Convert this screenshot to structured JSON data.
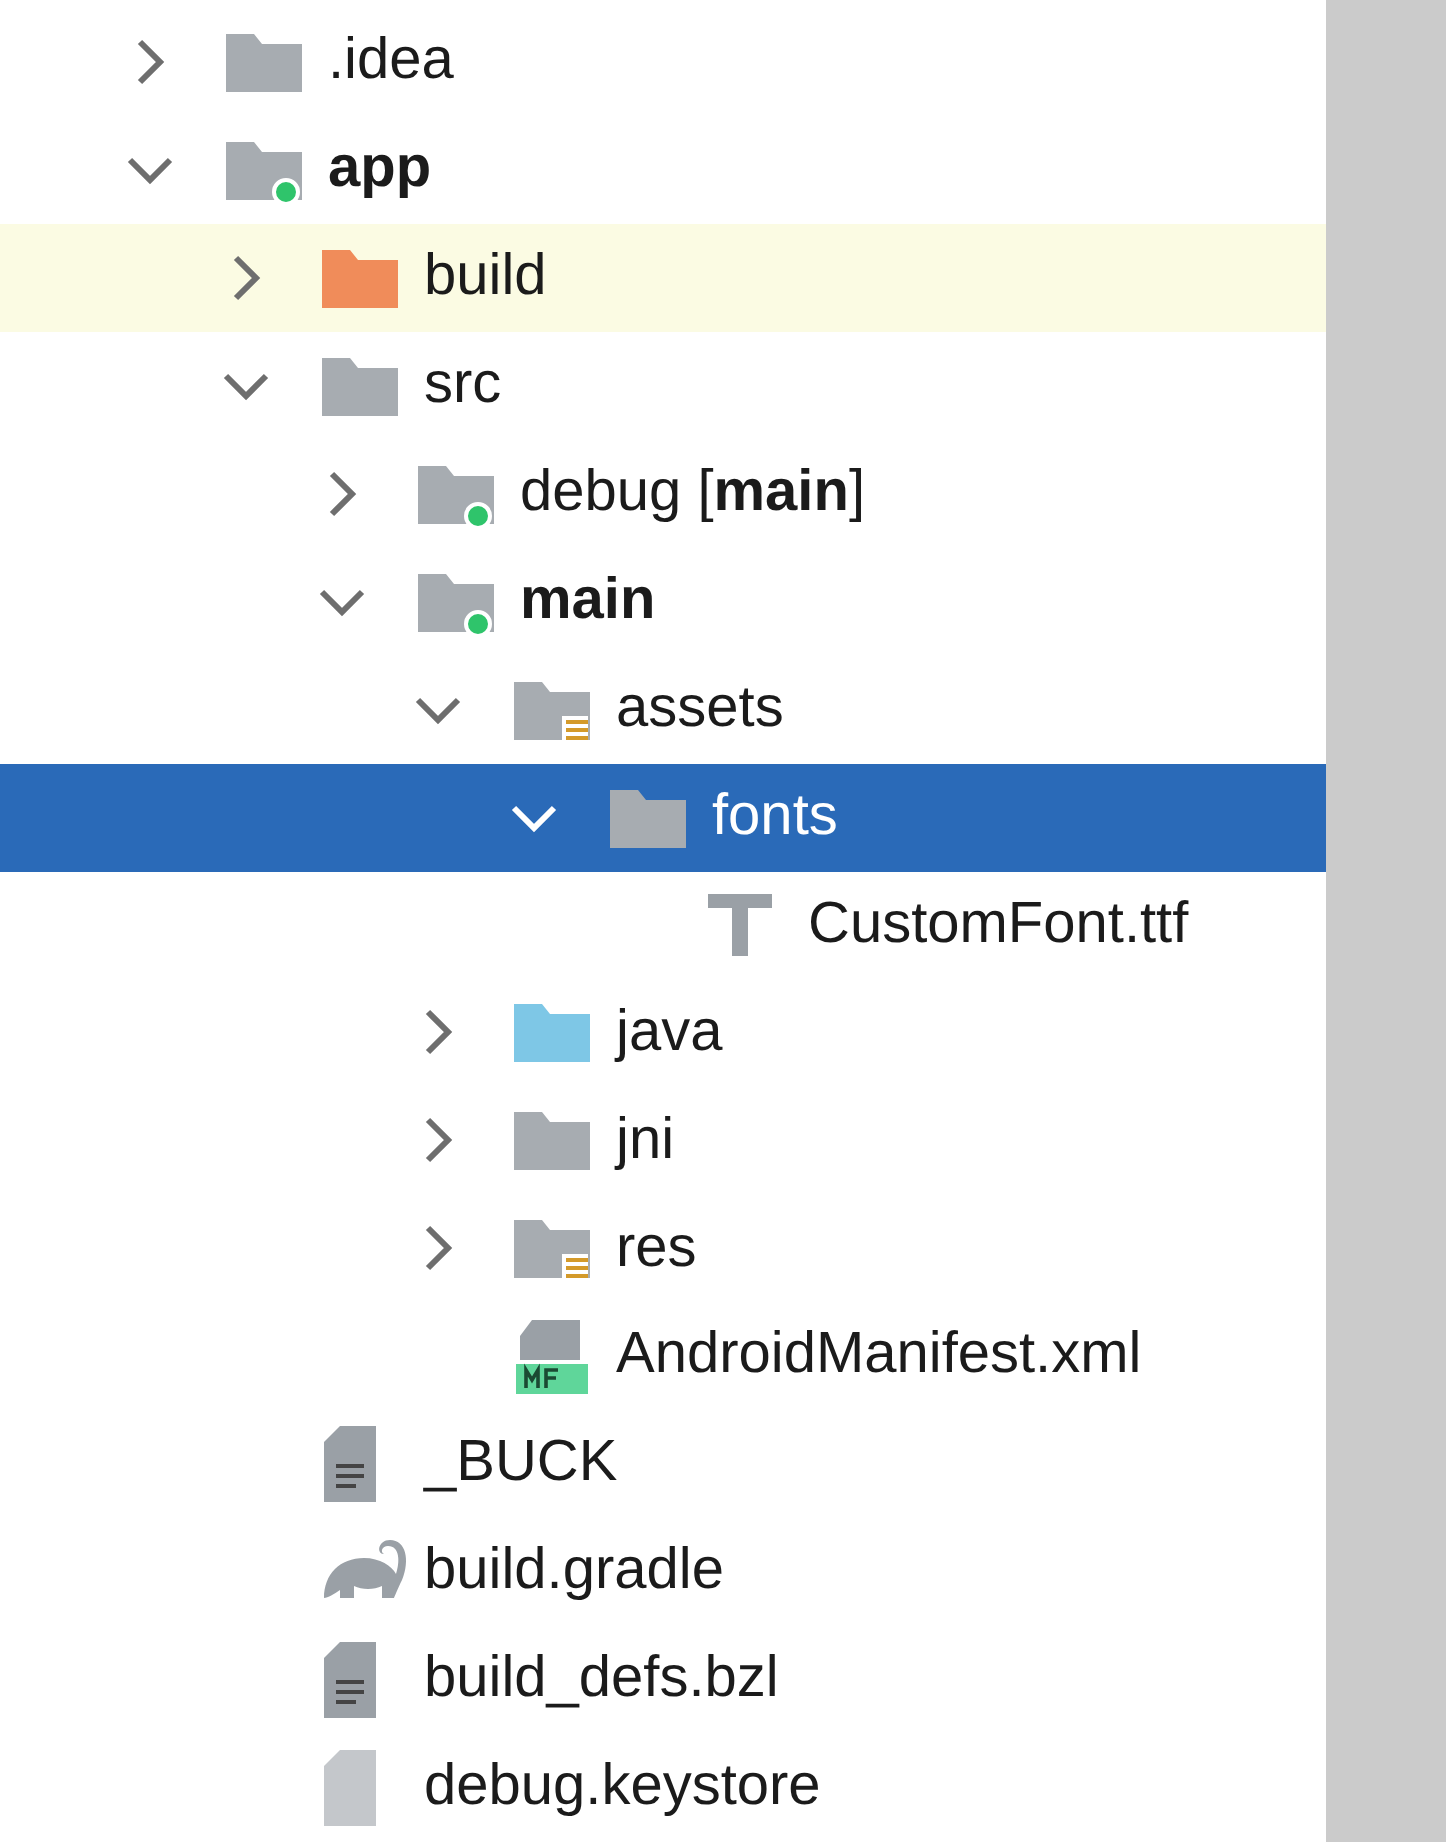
{
  "tree": [
    {
      "name": ".idea",
      "kind": "folder",
      "bold": false,
      "module": false,
      "expanded": false,
      "selected": false,
      "highlighted": false
    },
    {
      "name": "app",
      "kind": "folder",
      "bold": true,
      "module": true,
      "expanded": true,
      "selected": false,
      "highlighted": false,
      "children": [
        {
          "name": "build",
          "kind": "excluded-folder",
          "bold": false,
          "module": false,
          "expanded": false,
          "selected": false,
          "highlighted": true
        },
        {
          "name": "src",
          "kind": "folder",
          "bold": false,
          "module": false,
          "expanded": true,
          "selected": false,
          "highlighted": false,
          "children": [
            {
              "name": "debug [**main**]",
              "kind": "folder",
              "bold": false,
              "module": true,
              "expanded": false,
              "selected": false,
              "highlighted": false
            },
            {
              "name": "main",
              "kind": "folder",
              "bold": true,
              "module": true,
              "expanded": true,
              "selected": false,
              "highlighted": false,
              "children": [
                {
                  "name": "assets",
                  "kind": "resource-folder",
                  "bold": false,
                  "module": false,
                  "expanded": true,
                  "selected": false,
                  "highlighted": false,
                  "children": [
                    {
                      "name": "fonts",
                      "kind": "folder",
                      "bold": false,
                      "module": false,
                      "expanded": true,
                      "selected": true,
                      "highlighted": false,
                      "children": [
                        {
                          "name": "CustomFont.ttf",
                          "kind": "font-file",
                          "bold": false,
                          "selected": false,
                          "highlighted": false
                        }
                      ]
                    }
                  ]
                },
                {
                  "name": "java",
                  "kind": "source-folder",
                  "bold": false,
                  "module": false,
                  "expanded": false,
                  "selected": false,
                  "highlighted": false
                },
                {
                  "name": "jni",
                  "kind": "folder",
                  "bold": false,
                  "module": false,
                  "expanded": false,
                  "selected": false,
                  "highlighted": false
                },
                {
                  "name": "res",
                  "kind": "resource-folder",
                  "bold": false,
                  "module": false,
                  "expanded": false,
                  "selected": false,
                  "highlighted": false
                },
                {
                  "name": "AndroidManifest.xml",
                  "kind": "manifest-file",
                  "bold": false,
                  "selected": false,
                  "highlighted": false
                }
              ]
            }
          ]
        },
        {
          "name": "_BUCK",
          "kind": "text-file",
          "bold": false,
          "selected": false,
          "highlighted": false
        },
        {
          "name": "build.gradle",
          "kind": "gradle-file",
          "bold": false,
          "selected": false,
          "highlighted": false
        },
        {
          "name": "build_defs.bzl",
          "kind": "text-file",
          "bold": false,
          "selected": false,
          "highlighted": false
        },
        {
          "name": "debug.keystore",
          "kind": "file",
          "bold": false,
          "selected": false,
          "highlighted": false
        }
      ]
    }
  ]
}
